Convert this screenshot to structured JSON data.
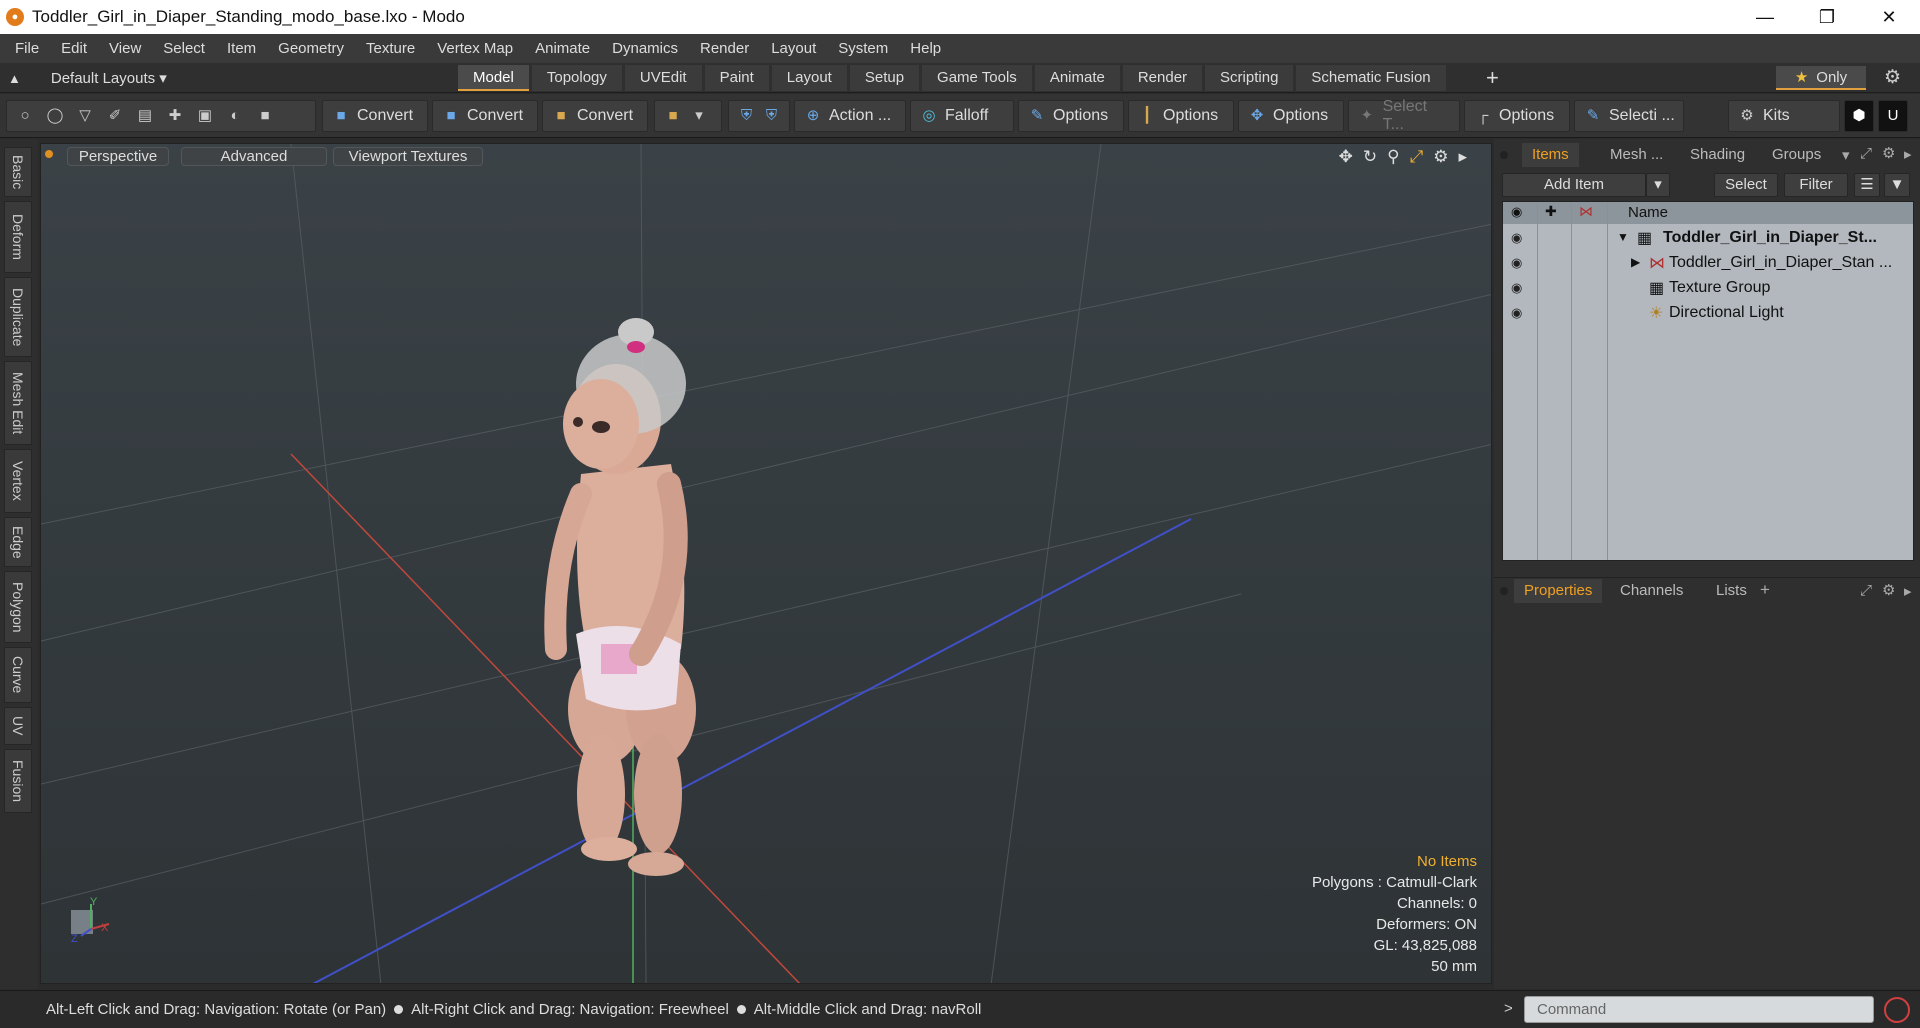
{
  "window": {
    "title": "Toddler_Girl_in_Diaper_Standing_modo_base.lxo - Modo",
    "controls": [
      "minimize-icon",
      "restore-icon",
      "close-icon"
    ]
  },
  "menu": [
    "File",
    "Edit",
    "View",
    "Select",
    "Item",
    "Geometry",
    "Texture",
    "Vertex Map",
    "Animate",
    "Dynamics",
    "Render",
    "Layout",
    "System",
    "Help"
  ],
  "layouts": {
    "label": "Default Layouts",
    "tabs": [
      "Model",
      "Topology",
      "UVEdit",
      "Paint",
      "Layout",
      "Setup",
      "Game Tools",
      "Animate",
      "Render",
      "Scripting",
      "Schematic Fusion"
    ],
    "active_tab": "Model",
    "only_label": "Only"
  },
  "toolbar": {
    "convert1": "Convert",
    "convert2": "Convert",
    "convert3": "Convert",
    "action": "Action ...",
    "falloff": "Falloff",
    "options1": "Options",
    "options2": "Options",
    "options3": "Options",
    "select_t": "Select T...",
    "options4": "Options",
    "selecti": "Selecti ...",
    "kits": "Kits"
  },
  "left_tabs": [
    "Basic",
    "Deform",
    "Duplicate",
    "Mesh Edit",
    "Vertex",
    "Edge",
    "Polygon",
    "Curve",
    "UV",
    "Fusion"
  ],
  "viewport": {
    "view": "Perspective",
    "shading": "Advanced",
    "textures": "Viewport Textures",
    "info": {
      "selection": "No Items",
      "polygons": "Polygons : Catmull-Clark",
      "channels": "Channels: 0",
      "deformers": "Deformers: ON",
      "gl": "GL: 43,825,088",
      "focal": "50 mm"
    },
    "axis_labels": {
      "y": "Y",
      "x": "X",
      "z": "Z"
    }
  },
  "items_panel": {
    "tabs": [
      "Items",
      "Mesh ...",
      "Shading",
      "Groups"
    ],
    "active_tab": "Items",
    "add_item": "Add Item",
    "select": "Select",
    "filter": "Filter",
    "column_name": "Name",
    "rows": [
      {
        "label": "Toddler_Girl_in_Diaper_St...",
        "bold": true
      },
      {
        "label": "Toddler_Girl_in_Diaper_Stan ...",
        "bold": false
      },
      {
        "label": "Texture Group",
        "bold": false
      },
      {
        "label": "Directional Light",
        "bold": false
      }
    ]
  },
  "properties_panel": {
    "tabs": [
      "Properties",
      "Channels",
      "Lists"
    ],
    "active_tab": "Properties"
  },
  "status": {
    "hint1": "Alt-Left Click and Drag: Navigation: Rotate (or Pan)",
    "hint2": "Alt-Right Click and Drag: Navigation: Freewheel",
    "hint3": "Alt-Middle Click and Drag: navRoll",
    "command_placeholder": "Command"
  }
}
